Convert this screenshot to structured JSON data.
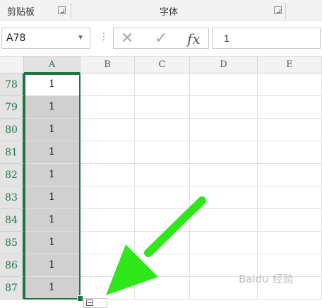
{
  "ribbon": {
    "groups": [
      "剪贴板",
      "字体"
    ],
    "launcher_icon": "dialog-launcher-icon"
  },
  "formula_bar": {
    "name_box": "A78",
    "cancel_icon": "✕",
    "enter_icon": "✓",
    "fx_label": "fx",
    "value": "1"
  },
  "grid": {
    "columns": [
      "A",
      "B",
      "C",
      "D",
      "E"
    ],
    "selected_column": "A",
    "rows": [
      {
        "num": "78",
        "a": "1"
      },
      {
        "num": "79",
        "a": "1"
      },
      {
        "num": "80",
        "a": "1"
      },
      {
        "num": "81",
        "a": "1"
      },
      {
        "num": "82",
        "a": "1"
      },
      {
        "num": "83",
        "a": "1"
      },
      {
        "num": "84",
        "a": "1"
      },
      {
        "num": "85",
        "a": "1"
      },
      {
        "num": "86",
        "a": "1"
      },
      {
        "num": "87",
        "a": "1"
      }
    ],
    "active_row": "78"
  },
  "annotation": {
    "color": "#2ee81a",
    "icon": "arrow-pointer-icon"
  },
  "watermark": "Baidu 经验"
}
